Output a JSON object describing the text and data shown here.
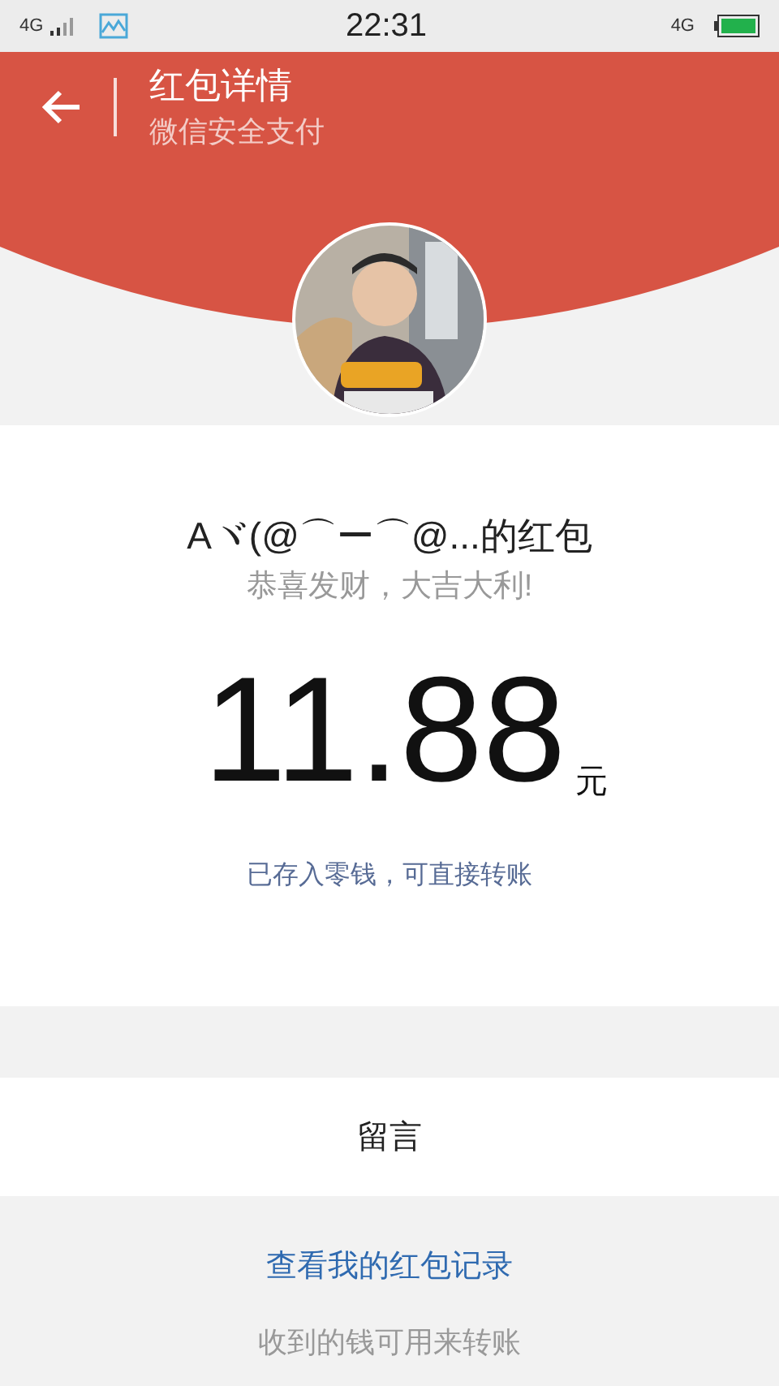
{
  "status_bar": {
    "network": "4G",
    "time": "22:31",
    "network_right": "4G"
  },
  "header": {
    "title": "红包详情",
    "subtitle": "微信安全支付"
  },
  "sender": "Aヾ(@⌒ー⌒@...的红包",
  "greeting": "恭喜发财，大吉大利!",
  "amount": "11.88",
  "unit": "元",
  "note": "已存入零钱，可直接转账",
  "message_row": {
    "label": "留言"
  },
  "records_link": "查看我的红包记录",
  "footer_note": "收到的钱可用来转账"
}
